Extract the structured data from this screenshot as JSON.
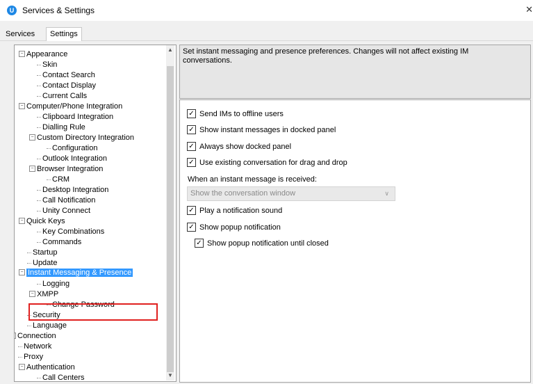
{
  "window": {
    "title": "Services & Settings",
    "app_icon_letter": "U",
    "close_glyph": "✕"
  },
  "tabs": [
    {
      "label": "Services"
    },
    {
      "label": "Settings"
    }
  ],
  "tree": {
    "items": [
      {
        "label": "Appearance"
      },
      {
        "label": "Skin"
      },
      {
        "label": "Contact Search"
      },
      {
        "label": "Contact Display"
      },
      {
        "label": "Current Calls"
      },
      {
        "label": "Computer/Phone Integration"
      },
      {
        "label": "Clipboard Integration"
      },
      {
        "label": "Dialling Rule"
      },
      {
        "label": "Custom Directory Integration"
      },
      {
        "label": "Configuration"
      },
      {
        "label": "Outlook Integration"
      },
      {
        "label": "Browser Integration"
      },
      {
        "label": "CRM"
      },
      {
        "label": "Desktop Integration"
      },
      {
        "label": "Call Notification"
      },
      {
        "label": "Unity Connect"
      },
      {
        "label": "Quick Keys"
      },
      {
        "label": "Key Combinations"
      },
      {
        "label": "Commands"
      },
      {
        "label": "Startup"
      },
      {
        "label": "Update"
      },
      {
        "label": "Instant Messaging & Presence"
      },
      {
        "label": "Logging"
      },
      {
        "label": "XMPP"
      },
      {
        "label": "Change Password"
      },
      {
        "label": "Security"
      },
      {
        "label": "Language"
      },
      {
        "label": "Connection"
      },
      {
        "label": "Network"
      },
      {
        "label": "Proxy"
      },
      {
        "label": "Authentication"
      },
      {
        "label": "Call Centers"
      }
    ],
    "expander_glyph": "−",
    "scroll_up_glyph": "▲",
    "scroll_down_glyph": "▼"
  },
  "description": "Set instant messaging and presence preferences.  Changes will not affect existing IM conversations.",
  "options": {
    "check_glyph": "✓",
    "checkboxes": [
      {
        "label": "Send IMs to offline users",
        "checked": true
      },
      {
        "label": "Show instant messages in docked panel",
        "checked": true
      },
      {
        "label": "Always show docked panel",
        "checked": true
      },
      {
        "label": "Use existing conversation for drag and drop",
        "checked": true
      },
      {
        "label": "Play a notification sound",
        "checked": true
      },
      {
        "label": "Show popup notification",
        "checked": true
      },
      {
        "label": "Show popup notification until closed",
        "checked": true
      }
    ],
    "received_label": "When an instant message is received:",
    "received_value": "Show the conversation window",
    "combo_arrow": "∨"
  },
  "colors": {
    "selection": "#3399ff",
    "highlight_border": "#e0201f",
    "app_icon": "#1e88e5"
  }
}
